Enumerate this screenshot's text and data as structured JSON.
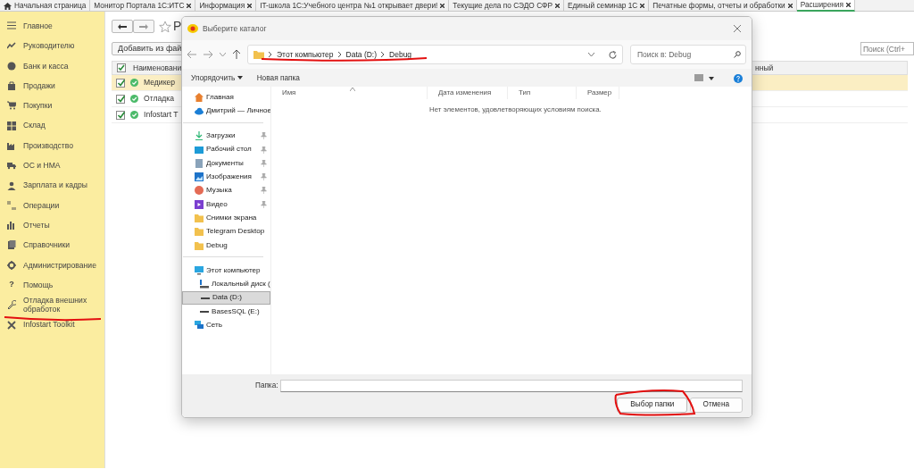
{
  "tabs": [
    {
      "label": "Начальная страница",
      "kind": "home",
      "selected": false
    },
    {
      "label": "Монитор Портала 1С:ИТС",
      "kind": "page",
      "selected": false
    },
    {
      "label": "Информация",
      "kind": "page",
      "selected": false
    },
    {
      "label": "IT-школа 1С:Учебного центра №1 открывает двери!",
      "kind": "page",
      "selected": false
    },
    {
      "label": "Текущие дела по СЭДО СФР",
      "kind": "page",
      "selected": false
    },
    {
      "label": "Единый семинар 1С",
      "kind": "page",
      "selected": false
    },
    {
      "label": "Печатные формы, отчеты и обработки",
      "kind": "page",
      "selected": false
    },
    {
      "label": "Расширения",
      "kind": "page",
      "selected": true
    }
  ],
  "sidebar": {
    "items": [
      {
        "label": "Главное"
      },
      {
        "label": "Руководителю"
      },
      {
        "label": "Банк и касса"
      },
      {
        "label": "Продажи"
      },
      {
        "label": "Покупки"
      },
      {
        "label": "Склад"
      },
      {
        "label": "Производство"
      },
      {
        "label": "ОС и НМА"
      },
      {
        "label": "Зарплата и кадры"
      },
      {
        "label": "Операции"
      },
      {
        "label": "Отчеты"
      },
      {
        "label": "Справочники"
      },
      {
        "label": "Администрирование"
      },
      {
        "label": "Помощь",
        "glyph": "?"
      },
      {
        "label": "Отладка внешних обработок"
      },
      {
        "label": "Infostart Toolkit"
      }
    ]
  },
  "main": {
    "add_button": "Добавить из фай",
    "title": "Р",
    "search": {
      "placeholder": "Поиск (Ctrl+"
    },
    "table": {
      "columns": [
        "Наименовани",
        "нный"
      ],
      "rows": [
        {
          "name": "Медикер",
          "checked": true,
          "selected": true
        },
        {
          "name": "Отладка",
          "checked": true,
          "selected": false
        },
        {
          "name": "Infostart T",
          "checked": true,
          "selected": false
        }
      ]
    }
  },
  "dialog": {
    "title": "Выберите каталог",
    "path": [
      "Этот компьютер",
      "Data (D:)",
      "Debug"
    ],
    "search": {
      "placeholder": "Поиск в: Debug"
    },
    "toolbar": {
      "organize": "Упорядочить",
      "new_folder": "Новая папка"
    },
    "nav": [
      {
        "label": "Главная",
        "kind": "home",
        "pinned": false,
        "selected": false
      },
      {
        "label": "Дмитрий — Личное",
        "kind": "cloud",
        "pinned": false,
        "selected": false
      },
      {
        "kind": "separator"
      },
      {
        "label": "Загрузки",
        "kind": "downloads",
        "pinned": true,
        "selected": false
      },
      {
        "label": "Рабочий стол",
        "kind": "desktop",
        "pinned": true,
        "selected": false
      },
      {
        "label": "Документы",
        "kind": "documents",
        "pinned": true,
        "selected": false
      },
      {
        "label": "Изображения",
        "kind": "pictures",
        "pinned": true,
        "selected": false
      },
      {
        "label": "Музыка",
        "kind": "music",
        "pinned": true,
        "selected": false
      },
      {
        "label": "Видео",
        "kind": "video",
        "pinned": true,
        "selected": false
      },
      {
        "label": "Снимки экрана",
        "kind": "folder",
        "pinned": false,
        "selected": false
      },
      {
        "label": "Telegram Desktop",
        "kind": "folder",
        "pinned": false,
        "selected": false
      },
      {
        "label": "Debug",
        "kind": "folder",
        "pinned": false,
        "selected": false
      },
      {
        "kind": "separator"
      },
      {
        "label": "Этот компьютер",
        "kind": "computer",
        "pinned": false,
        "selected": false,
        "children": [
          {
            "label": "Локальный диск (",
            "kind": "disk",
            "pinned": false,
            "selected": false
          },
          {
            "label": "Data (D:)",
            "kind": "drive",
            "pinned": false,
            "selected": true
          },
          {
            "label": "BasesSQL (E:)",
            "kind": "drive",
            "pinned": false,
            "selected": false
          }
        ]
      },
      {
        "label": "Сеть",
        "kind": "network",
        "pinned": false,
        "selected": false
      }
    ],
    "columns": [
      "Имя",
      "Дата изменения",
      "Тип",
      "Размер"
    ],
    "empty_message": "Нет элементов, удовлетворяющих условиям поиска.",
    "folder_label": "Папка:",
    "buttons": [
      {
        "label": "Выбор папки",
        "kind": "primary"
      },
      {
        "label": "Отмена",
        "kind": "secondary"
      }
    ]
  }
}
